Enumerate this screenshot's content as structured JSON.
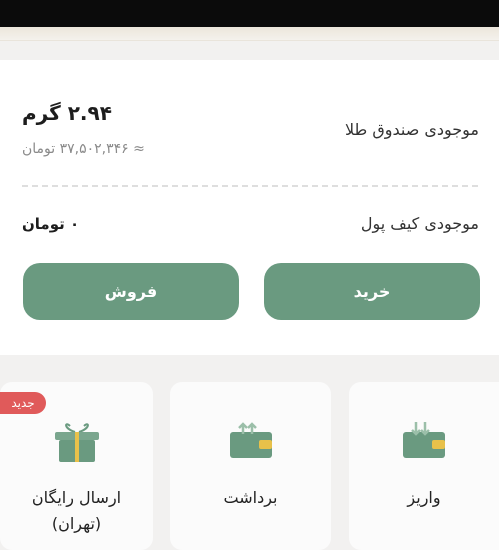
{
  "gold_fund": {
    "label": "موجودی صندوق طلا",
    "amount": "۲.۹۴ گرم",
    "toman_value": "≈ ۳۷,۵۰۲,۳۴۶ تومان"
  },
  "wallet": {
    "label": "موجودی کیف پول",
    "amount": "۰ تومان"
  },
  "buttons": {
    "buy": "خرید",
    "sell": "فروش"
  },
  "actions": [
    {
      "label": "واریز",
      "icon": "wallet-deposit-icon"
    },
    {
      "label": "برداشت",
      "icon": "wallet-withdraw-icon"
    },
    {
      "label_line1": "ارسال رایگان",
      "label_line2": "(تهران)",
      "icon": "gift-icon",
      "badge": "جدید"
    }
  ],
  "colors": {
    "accent": "#6a9a80",
    "badge": "#e05a5a",
    "icon_yellow": "#e8c14a"
  }
}
